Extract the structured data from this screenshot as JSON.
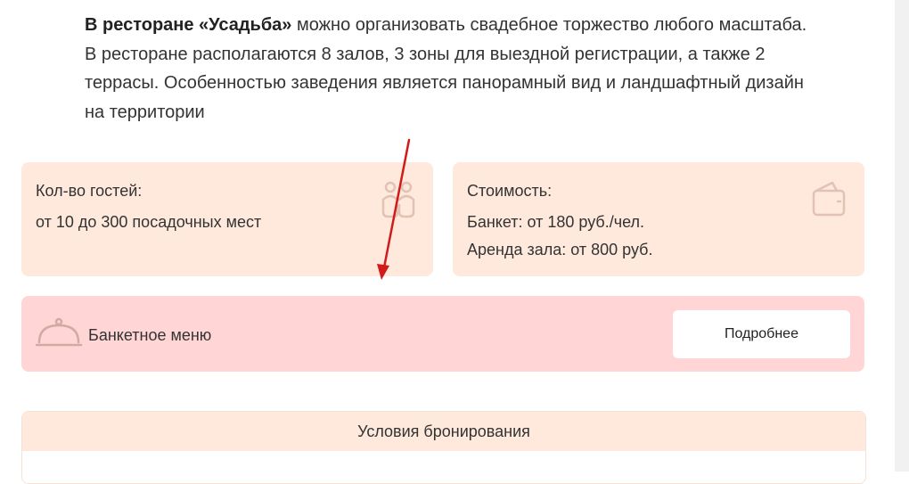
{
  "intro": {
    "bold": "В ресторане «Усадьба»",
    "text": " можно организовать свадебное торжество любого масштаба. В ресторане располагаются 8 залов, 3 зоны для выездной регистрации, а также 2 террасы. Особенностью заведения является панорамный вид и ландшафтный дизайн на территории"
  },
  "guests_card": {
    "label": "Кол-во гостей:",
    "value": "от 10 до 300 посадочных мест",
    "icon": "guests-icon"
  },
  "price_card": {
    "label": "Стоимость:",
    "banquet": "Банкет: от 180 руб./чел.",
    "rent": "Аренда зала: от 800 руб.",
    "icon": "wallet-icon"
  },
  "menu_bar": {
    "label": "Банкетное меню",
    "button": "Подробнее",
    "icon": "cloche-icon"
  },
  "booking": {
    "title": "Условия бронирования"
  },
  "colors": {
    "card_bg": "#ffe9dc",
    "menu_bg": "#ffd6d5",
    "icon": "#d9b8a8",
    "arrow": "#d11a1a"
  }
}
